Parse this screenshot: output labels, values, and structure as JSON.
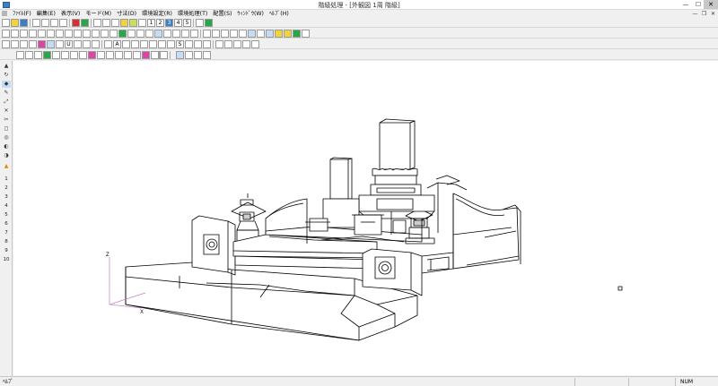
{
  "window": {
    "title": "階級処理 - [外観図  1周    階級]",
    "min": "—",
    "max": "☐",
    "close": "✕"
  },
  "menubar": {
    "items": [
      "ﾌｧｲﾙ(F)",
      "編集(E)",
      "表示(V)",
      "モード(M)",
      "寸法(D)",
      "環境設定(R)",
      "環境処理(T)",
      "配置(S)",
      "ｳｨﾝﾄﾞｳ(W)",
      "ﾍﾙﾌﾟ(H)"
    ],
    "mdi_min": "—",
    "mdi_max": "❐",
    "mdi_close": "✕"
  },
  "toolbar1": {
    "numbers": [
      "1",
      "2",
      "3",
      "4",
      "5"
    ]
  },
  "left_palette": {
    "numbers": [
      "1",
      "2",
      "3",
      "4",
      "5",
      "6",
      "7",
      "8",
      "9",
      "10"
    ]
  },
  "canvas": {
    "axes": {
      "x": "X",
      "z": "Z"
    }
  },
  "statusbar": {
    "left": "ﾍﾙﾌﾟ",
    "num": "NUM"
  },
  "colors": {
    "accent_blue": "#3c7fc6",
    "active_button": "#c4ddf5",
    "yellow_icon": "#f1d340",
    "green_icon": "#27a745",
    "magenta_icon": "#d946a6",
    "axis_color": "#c080c0"
  }
}
